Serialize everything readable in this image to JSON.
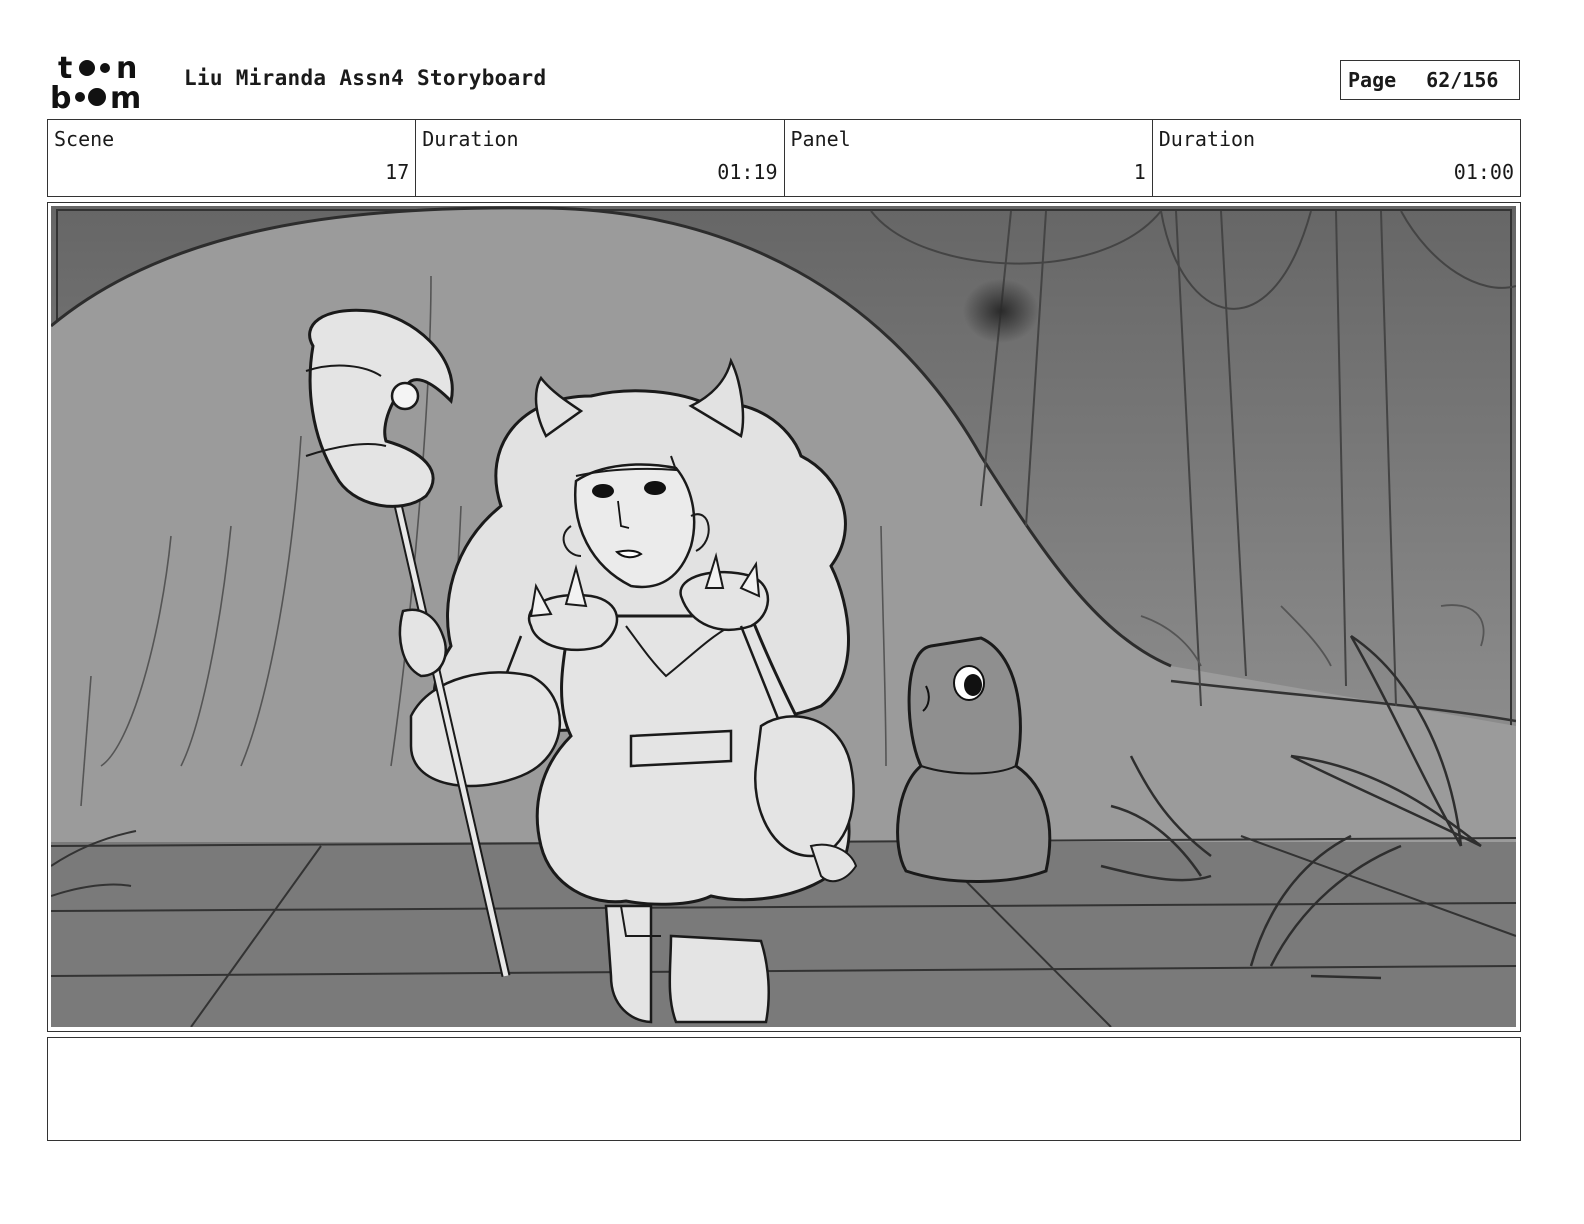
{
  "header": {
    "logo_text": "toon boom",
    "doc_title": "Liu Miranda Assn4 Storyboard",
    "page_label": "Page",
    "page_value": "62/156"
  },
  "info": {
    "scene_label": "Scene",
    "scene_value": "17",
    "scene_duration_label": "Duration",
    "scene_duration_value": "01:19",
    "panel_label": "Panel",
    "panel_value": "1",
    "panel_duration_label": "Duration",
    "panel_duration_value": "01:00"
  },
  "notes": {
    "text": ""
  }
}
